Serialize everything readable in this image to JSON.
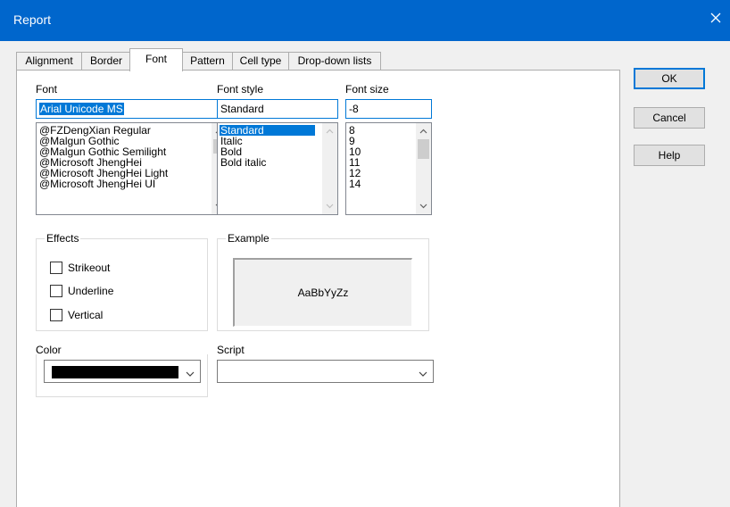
{
  "window": {
    "title": "Report",
    "close_icon": "close-icon"
  },
  "tabs": [
    {
      "label": "Alignment",
      "active": false
    },
    {
      "label": "Border",
      "active": false
    },
    {
      "label": "Font",
      "active": true
    },
    {
      "label": "Pattern",
      "active": false
    },
    {
      "label": "Cell type",
      "active": false
    },
    {
      "label": "Drop-down lists",
      "active": false
    }
  ],
  "font": {
    "label": "Font",
    "value": "Arial Unicode MS",
    "items": [
      "@FZDengXian Regular",
      "@Malgun Gothic",
      "@Malgun Gothic Semilight",
      "@Microsoft JhengHei",
      "@Microsoft JhengHei Light",
      "@Microsoft JhengHei UI"
    ]
  },
  "font_style": {
    "label": "Font style",
    "value": "Standard",
    "items": [
      "Standard",
      "Italic",
      "Bold",
      "Bold italic"
    ],
    "selected_index": 0
  },
  "font_size": {
    "label": "Font size",
    "value": "-8",
    "items": [
      "8",
      "9",
      "10",
      "11",
      "12",
      "14"
    ]
  },
  "effects": {
    "label": "Effects",
    "strikeout": {
      "label": "Strikeout",
      "checked": false
    },
    "underline": {
      "label": "Underline",
      "checked": false
    },
    "vertical": {
      "label": "Vertical",
      "checked": false
    }
  },
  "example": {
    "label": "Example",
    "text": "AaBbYyZz"
  },
  "color": {
    "label": "Color",
    "value_color": "#000000"
  },
  "script": {
    "label": "Script",
    "value": ""
  },
  "buttons": {
    "ok": "OK",
    "cancel": "Cancel",
    "help": "Help"
  },
  "colors": {
    "titlebar": "#0066cc",
    "accent": "#0078d7",
    "panel": "#ffffff",
    "dialog": "#f0f0f0"
  }
}
